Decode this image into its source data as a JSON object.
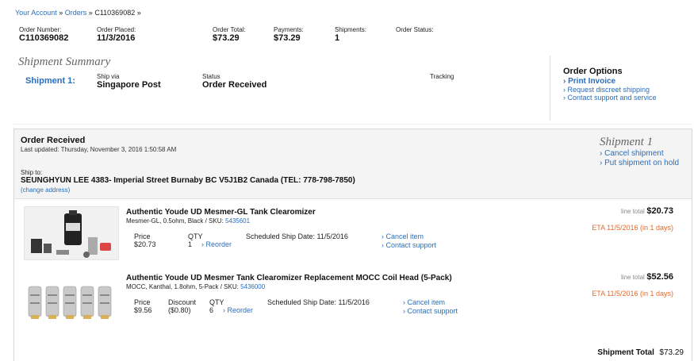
{
  "breadcrumb": {
    "account": "Your Account",
    "sep1": "»",
    "orders": "Orders",
    "sep2": "»",
    "current": "C110369082 »"
  },
  "summary": {
    "order_number_label": "Order Number:",
    "order_number": "C110369082",
    "order_placed_label": "Order Placed:",
    "order_placed": "11/3/2016",
    "order_total_label": "Order Total:",
    "order_total": "$73.29",
    "payments_label": "Payments:",
    "payments": "$73.29",
    "shipments_label": "Shipments:",
    "shipments": "1",
    "status_label": "Order Status:"
  },
  "shipment_summary": {
    "title": "Shipment Summary",
    "shipment_label": "Shipment 1",
    "colon": ":",
    "ship_via_label": "Ship via",
    "ship_via": "Singapore Post",
    "status_label": "Status",
    "status": "Order Received",
    "tracking_label": "Tracking"
  },
  "order_options": {
    "title": "Order Options",
    "print_invoice": "› Print Invoice",
    "request_discreet": "› Request discreet shipping",
    "contact_support": "› Contact support and service"
  },
  "shipment": {
    "status": "Order Received",
    "last_updated": "Last updated: Thursday, November 3, 2016 1:50:58 AM",
    "title": "Shipment 1",
    "cancel": "› Cancel shipment",
    "hold": "› Put shipment on hold",
    "ship_to_label": "Ship to:",
    "ship_to": "SEUNGHYUN LEE 4383- Imperial Street Burnaby BC V5J1B2 Canada (TEL: 778-798-7850)",
    "change_address": "(change address)",
    "total_label": "Shipment Total",
    "total": "$73.29"
  },
  "items": [
    {
      "name": "Authentic Youde UD Mesmer-GL Tank Clearomizer",
      "variant": "Mesmer-GL, 0.5ohm, Black / SKU: ",
      "sku": "5435601",
      "price_label": "Price",
      "price": "$20.73",
      "qty_label": "QTY",
      "qty": "1",
      "reorder": "› Reorder",
      "ship_date": "Scheduled Ship Date: 11/5/2016",
      "cancel_item": "› Cancel item",
      "contact": "› Contact support",
      "line_total_label": "line total",
      "line_total": "$20.73",
      "eta": "ETA 11/5/2016 (in 1 days)"
    },
    {
      "name": "Authentic Youde UD Mesmer Tank Clearomizer Replacement MOCC Coil Head (5-Pack)",
      "variant": "MOCC, Kanthal, 1.8ohm, 5-Pack / SKU: ",
      "sku": "5436000",
      "price_label": "Price",
      "price": "$9.56",
      "discount_label": "Discount",
      "discount": "($0.80)",
      "qty_label": "QTY",
      "qty": "6",
      "reorder": "› Reorder",
      "ship_date": "Scheduled Ship Date: 11/5/2016",
      "cancel_item": "› Cancel item",
      "contact": "› Contact support",
      "line_total_label": "line total",
      "line_total": "$52.56",
      "eta": "ETA 11/5/2016 (in 1 days)"
    }
  ],
  "colors": {
    "link": "#2a6ebb",
    "eta": "#e36a2c",
    "header_bg": "#f4f4f4"
  }
}
